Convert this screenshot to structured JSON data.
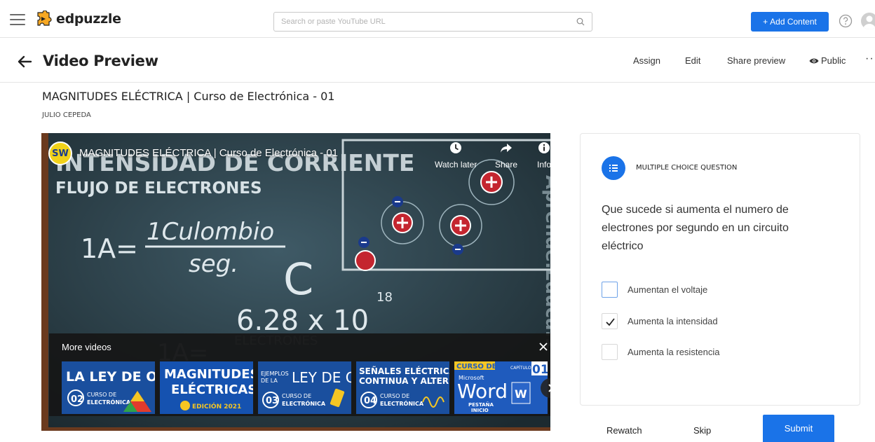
{
  "app": {
    "brand": "edpuzzle",
    "search_placeholder": "Search or paste YouTube URL",
    "add_content_label": "Add Content",
    "accent": "#1a73e8"
  },
  "page": {
    "title": "Video Preview",
    "actions": {
      "assign": "Assign",
      "edit": "Edit",
      "share": "Share preview",
      "visibility": "Public",
      "more": "···"
    }
  },
  "video": {
    "title": "MAGNITUDES ELÉCTRICA | Curso de Electrónica - 01",
    "author": "JULIO CEPEDA",
    "player": {
      "channel_badge": "SW",
      "embed_title": "MAGNITUDES ELÉCTRICA | Curso de Electrónica - 01",
      "watch_later": "Watch later",
      "share": "Share",
      "info": "Info",
      "more_videos": "More videos"
    }
  },
  "question": {
    "type": "MULTIPLE CHOICE QUESTION",
    "text": "Que sucede si aumenta el numero de electrones por segundo en un circuito eléctrico",
    "options": [
      {
        "label": "Aumentan el voltaje",
        "checked": false
      },
      {
        "label": "Aumenta la intensidad",
        "checked": true
      },
      {
        "label": "Aumenta la resistencia",
        "checked": false
      }
    ]
  },
  "footer": {
    "rewatch": "Rewatch",
    "skip": "Skip",
    "submit": "Submit"
  }
}
